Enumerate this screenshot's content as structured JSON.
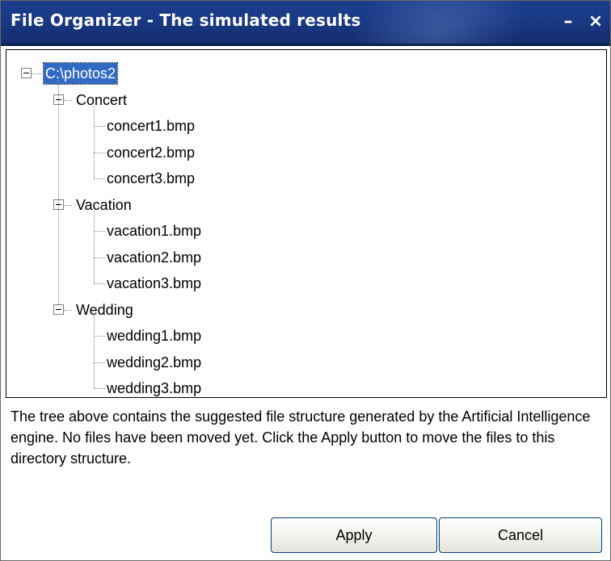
{
  "window": {
    "title": "File Organizer - The simulated results",
    "minimize_glyph": "–",
    "close_glyph": "×"
  },
  "tree": {
    "root": "C:\\photos2",
    "folders": [
      {
        "name": "Concert",
        "expanded": true,
        "files": [
          "concert1.bmp",
          "concert2.bmp",
          "concert3.bmp"
        ]
      },
      {
        "name": "Vacation",
        "expanded": true,
        "files": [
          "vacation1.bmp",
          "vacation2.bmp",
          "vacation3.bmp"
        ]
      },
      {
        "name": "Wedding",
        "expanded": true,
        "files": [
          "wedding1.bmp",
          "wedding2.bmp",
          "wedding3.bmp"
        ]
      }
    ]
  },
  "description": "The tree above contains the suggested file structure generated by the Artificial Intelligence engine. No files have been moved yet. Click the Apply button to move the files to this directory structure.",
  "buttons": {
    "apply": "Apply",
    "cancel": "Cancel"
  },
  "colors": {
    "titlebar": "#1a3a86",
    "selection": "#316ac5"
  }
}
